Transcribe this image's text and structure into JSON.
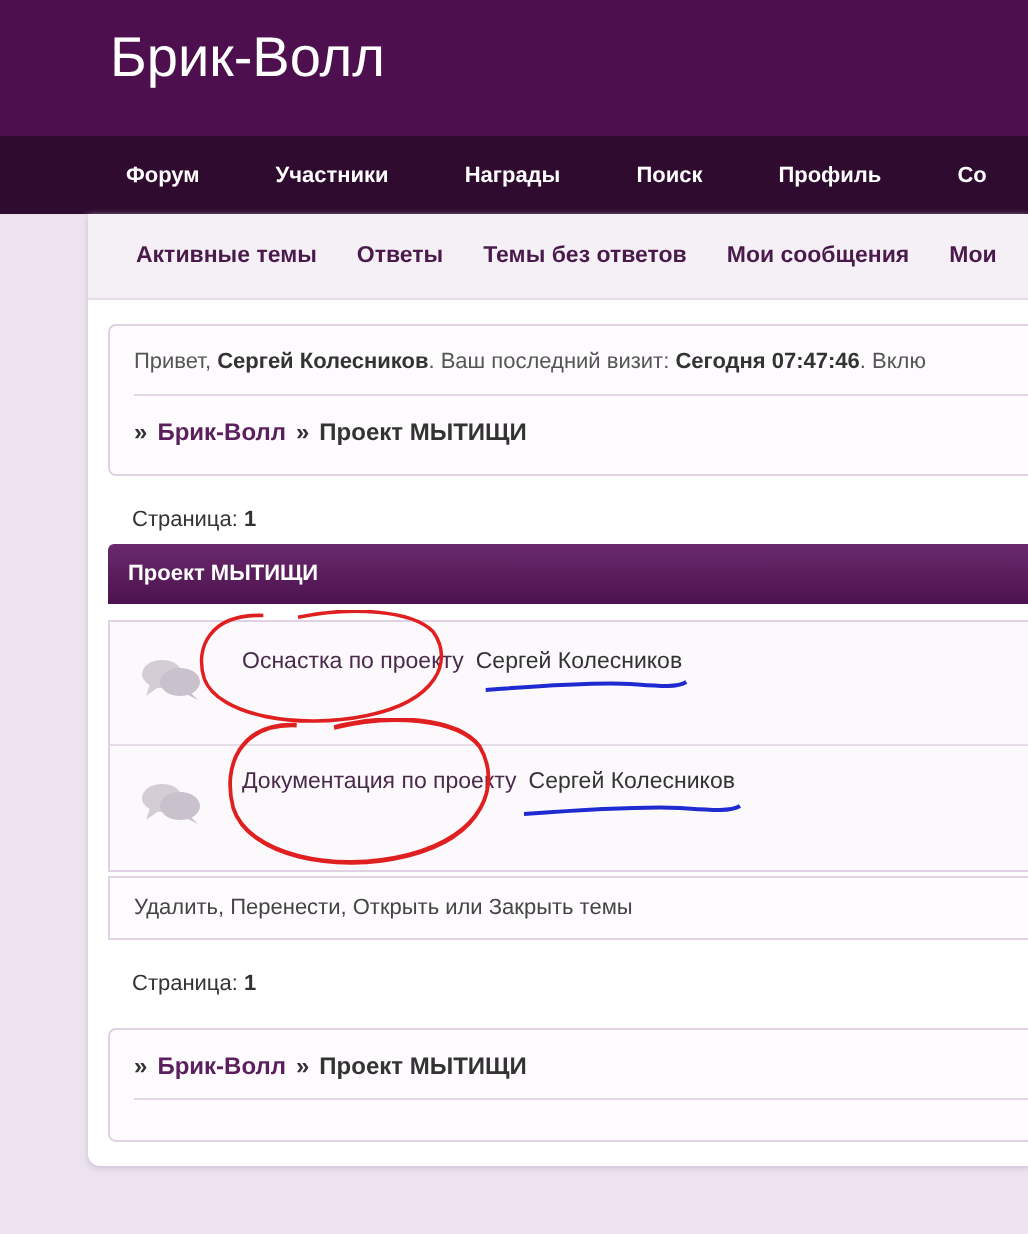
{
  "site_title": "Брик-Волл",
  "main_nav": [
    "Форум",
    "Участники",
    "Награды",
    "Поиск",
    "Профиль",
    "Со"
  ],
  "sub_nav": [
    "Активные темы",
    "Ответы",
    "Темы без ответов",
    "Мои сообщения",
    "Мои"
  ],
  "welcome": "Привет, **Сергей Колесников**.  Ваш последний визит: **Сегодня 07:47:46**.  Вклю",
  "breadcrumb_top": {
    "prefix": "»",
    "link": "Брик-Волл",
    "separator": "»",
    "current": "Проект МЫТИЩИ"
  },
  "page_label_top": "Страница: **1**",
  "category_title": "Проект МЫТИЩИ",
  "topics": [
    {
      "title": "Оснастка по проекту",
      "author": "Сергей Колесников",
      "annotated": true
    },
    {
      "title": "Документация по проекту",
      "author": "Сергей Колесников",
      "annotated": true
    }
  ],
  "moderation": "Удалить, Перенести, Открыть или Закрыть темы",
  "page_label_bottom": "Страница: **1**",
  "breadcrumb_bottom": {
    "prefix": "»",
    "link": "Брик-Волл",
    "separator": "»",
    "current": "Проект МЫТИЩИ"
  }
}
